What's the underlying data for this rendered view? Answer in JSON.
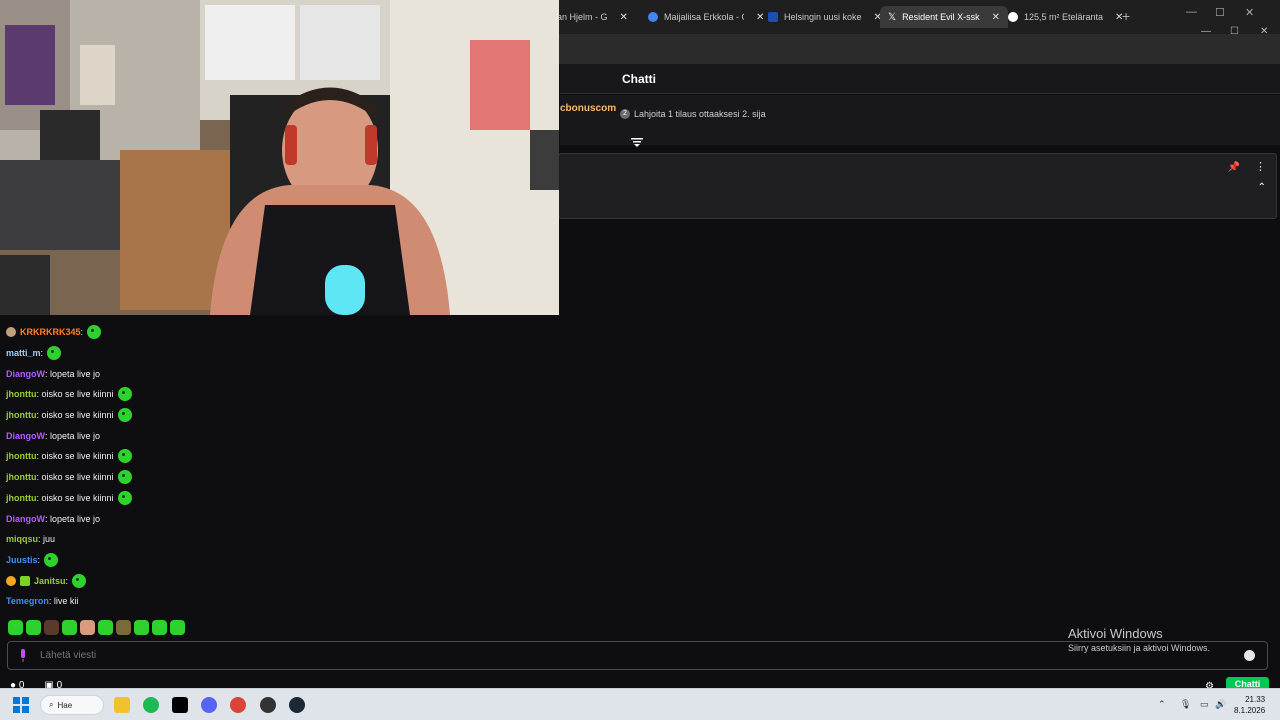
{
  "browser": {
    "tabs": [
      {
        "label": "stian Hjelm - G",
        "favicon_color": "#6a6a6a"
      },
      {
        "label": "Maijaliisa Erkkola - G",
        "favicon_color": "#4285f4"
      },
      {
        "label": "Helsingin uusi koke",
        "favicon_color": "#1e4db7"
      },
      {
        "label": "Resident Evil X-ssk",
        "favicon_color": "#000000"
      },
      {
        "label": "125,5 m² Eteläranta",
        "favicon_color": "#ffffff"
      }
    ],
    "active_tab_index": 3,
    "new_tab_label": "+",
    "window_controls": [
      "—",
      "☐",
      "✕"
    ],
    "window_controls_secondary": [
      "—",
      "☐",
      "✕"
    ]
  },
  "chat": {
    "title": "Chatti",
    "promo_user": "cbonuscom",
    "gift_text": "Lahjoita 1 tilaus ottaaksesi 2. sija",
    "gift_badge": "2",
    "messages": [
      {
        "user": "KRKRKRK345",
        "color": "#ff7f2a",
        "text": "",
        "emotes": 1,
        "badge": "#c0a080"
      },
      {
        "user": "matti_m",
        "color": "#9ad0ff",
        "text": "",
        "emotes": 1
      },
      {
        "user": "DiangoW",
        "color": "#b05cff",
        "text": "lopeta live jo",
        "emotes": 0
      },
      {
        "user": "jhonttu",
        "color": "#9acd32",
        "text": "oisko se live kiinni",
        "emotes": 1
      },
      {
        "user": "jhonttu",
        "color": "#9acd32",
        "text": "oisko se live kiinni",
        "emotes": 1
      },
      {
        "user": "DiangoW",
        "color": "#b05cff",
        "text": "lopeta live jo",
        "emotes": 0
      },
      {
        "user": "jhonttu",
        "color": "#9acd32",
        "text": "oisko se live kiinni",
        "emotes": 1
      },
      {
        "user": "jhonttu",
        "color": "#9acd32",
        "text": "oisko se live kiinni",
        "emotes": 1
      },
      {
        "user": "jhonttu",
        "color": "#9acd32",
        "text": "oisko se live kiinni",
        "emotes": 1
      },
      {
        "user": "DiangoW",
        "color": "#b05cff",
        "text": "lopeta live jo",
        "emotes": 0
      },
      {
        "user": "miqqsu",
        "color": "#9acd32",
        "text": "juu",
        "emotes": 0
      },
      {
        "user": "Juustis",
        "color": "#3c8dff",
        "text": "",
        "emotes": 1
      },
      {
        "user": "Janitsu",
        "color": "#9acd32",
        "text": "",
        "emotes": 1,
        "badge": "#f5a623"
      },
      {
        "user": "Temegron",
        "color": "#3c8dff",
        "text": "live kii",
        "emotes": 0
      }
    ],
    "input_placeholder": "Lähetä viesti",
    "points": "0",
    "points_label": "0",
    "viewers_label": "0",
    "chat_button": "Chatti",
    "settings_icon": "gear-icon"
  },
  "windows_activation": {
    "title": "Aktivoi Windows",
    "subtitle": "Siirry asetuksiin ja aktivoi Windows."
  },
  "taskbar": {
    "search_label": "Hae",
    "time": "21.33",
    "date": "8.1.2026"
  }
}
